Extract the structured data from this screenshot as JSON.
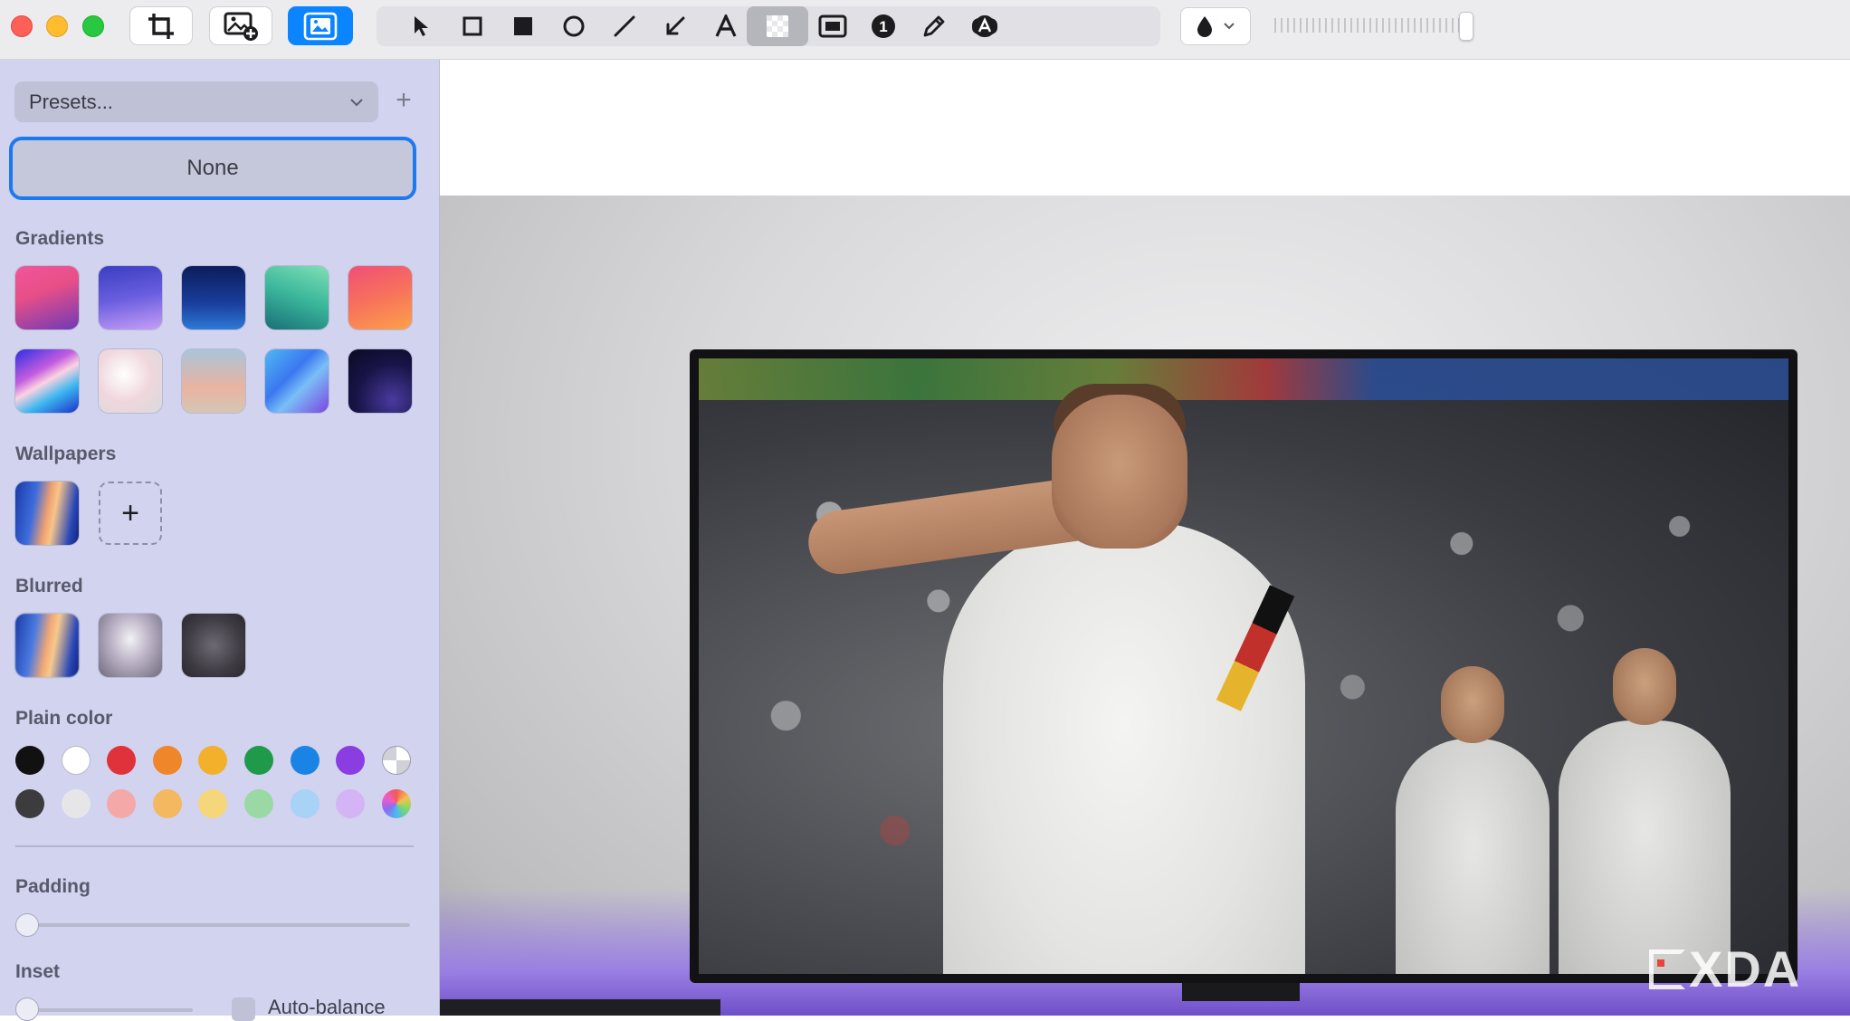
{
  "toolbar": {
    "tools": [
      {
        "name": "select-tool",
        "icon": "arrow-pointer-icon"
      },
      {
        "name": "rectangle-outline-tool",
        "icon": "square-outline-icon"
      },
      {
        "name": "rectangle-filled-tool",
        "icon": "square-filled-icon"
      },
      {
        "name": "ellipse-tool",
        "icon": "circle-outline-icon"
      },
      {
        "name": "line-tool",
        "icon": "line-icon"
      },
      {
        "name": "arrow-tool",
        "icon": "arrow-icon"
      },
      {
        "name": "text-tool",
        "icon": "text-a-icon"
      },
      {
        "name": "pixelate-tool",
        "icon": "checkerboard-icon",
        "active": true
      },
      {
        "name": "highlight-tool",
        "icon": "frame-icon"
      },
      {
        "name": "counter-tool",
        "icon": "number-one-icon",
        "label": "1"
      },
      {
        "name": "pen-tool",
        "icon": "pen-icon"
      },
      {
        "name": "smart-text-tool",
        "icon": "text-badge-icon"
      }
    ],
    "color_well_icon": "drop-icon",
    "opacity_percent": 100
  },
  "sidebar": {
    "presets_label": "Presets...",
    "none_label": "None",
    "gradients_title": "Gradients",
    "wallpapers_title": "Wallpapers",
    "blurred_title": "Blurred",
    "plain_color_title": "Plain color",
    "padding_title": "Padding",
    "inset_title": "Inset",
    "auto_balance_label": "Auto-balance",
    "plus_glyph": "+",
    "add_glyph": "+",
    "plain_colors_row1": [
      "#111111",
      "#ffffff",
      "#e0323a",
      "#f0862a",
      "#f2b02b",
      "#1e9a4a",
      "#1a84e6",
      "#8a3ee2"
    ],
    "plain_colors_row2": [
      "#3c3c3f",
      "#e6e6e8",
      "#f4a8a8",
      "#f4b860",
      "#f6d67a",
      "#9ad8a4",
      "#a8d2f6",
      "#d4b4f4"
    ],
    "padding_value": 0,
    "inset_value": 0
  },
  "watermark": "XDA"
}
